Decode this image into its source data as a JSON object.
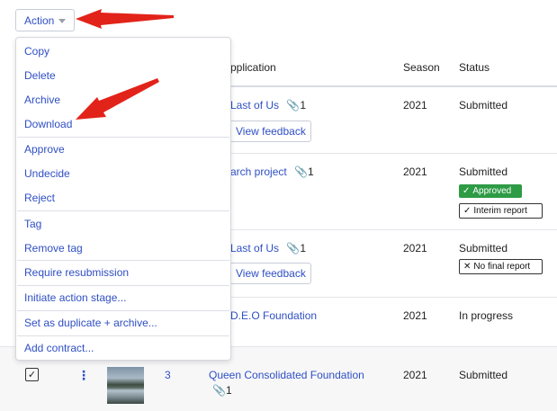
{
  "action_button": {
    "label": "Action"
  },
  "menu": {
    "items": [
      "Copy",
      "Delete",
      "Archive",
      "Download",
      "Approve",
      "Undecide",
      "Reject",
      "Tag",
      "Remove tag",
      "Require resubmission",
      "Initiate action stage...",
      "Set as duplicate + archive...",
      "Add contract..."
    ]
  },
  "table": {
    "headers": {
      "application": "pplication",
      "season": "Season",
      "status": "Status"
    },
    "rows": [
      {
        "application": "Last of Us",
        "attachments": "1",
        "feedback": "View feedback",
        "season": "2021",
        "status": "Submitted"
      },
      {
        "application": "arch project",
        "attachments": "1",
        "season": "2021",
        "status": "Submitted",
        "badges": [
          "Approved",
          "Interim report"
        ]
      },
      {
        "application": "Last of Us",
        "attachments": "1",
        "feedback": "View feedback",
        "season": "2021",
        "status": "Submitted",
        "badges": [
          "No final report"
        ]
      },
      {
        "application": "D.E.O Foundation",
        "season": "2021",
        "status": "In progress"
      },
      {
        "number": "3",
        "application": "Queen Consolidated Foundation",
        "attachments": "1",
        "season": "2021",
        "status": "Submitted"
      }
    ]
  },
  "colors": {
    "link": "#2f4fc4",
    "approved": "#2e9b45",
    "arrow": "#e2231a"
  }
}
